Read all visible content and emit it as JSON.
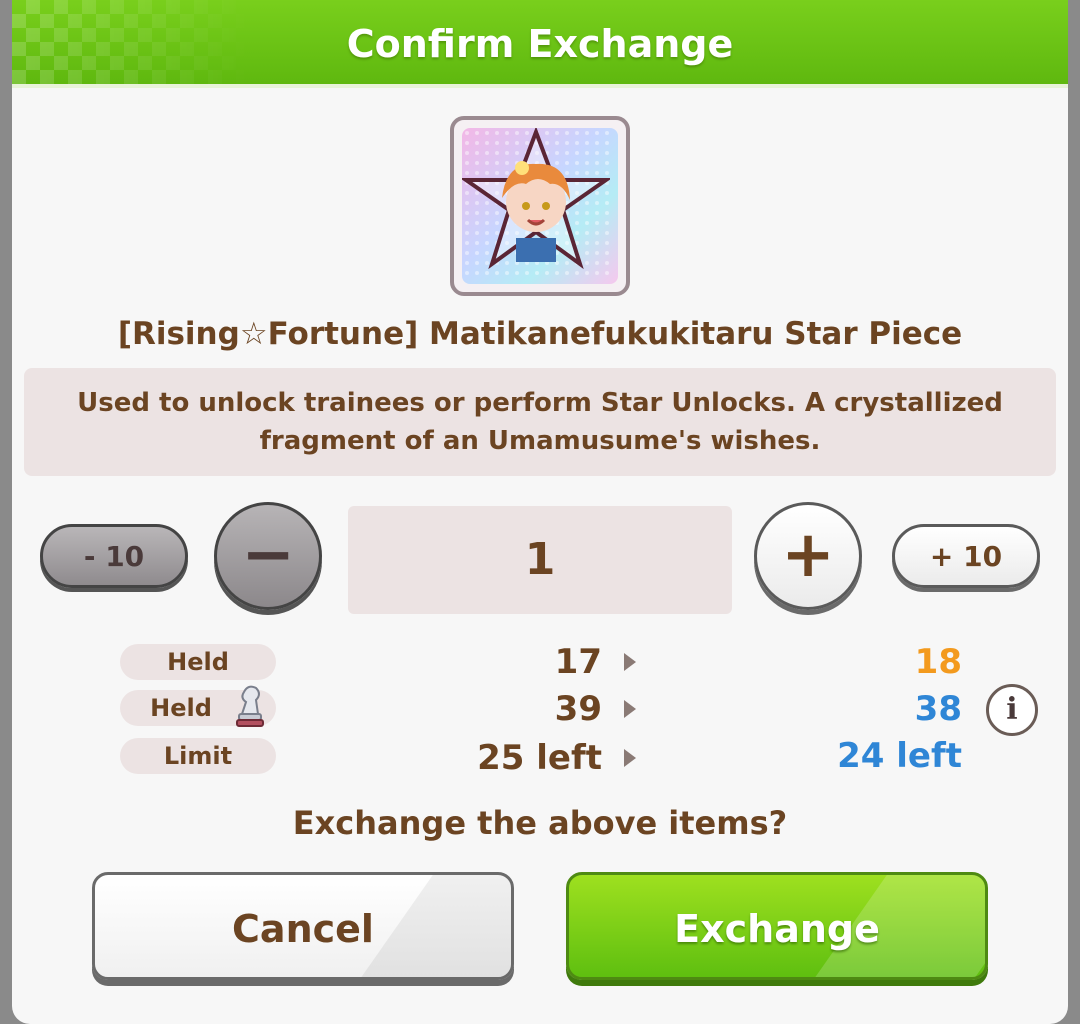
{
  "dialog": {
    "title": "Confirm Exchange",
    "item_name": "[Rising☆Fortune] Matikanefukukitaru Star Piece",
    "description_line1": "Used to unlock trainees or perform Star Unlocks. A crystallized",
    "description_line2": "fragment of an Umamusume's wishes."
  },
  "quantity": {
    "minus10_label": "- 10",
    "minus_label": "−",
    "value": "1",
    "plus_label": "+",
    "plus10_label": "+ 10"
  },
  "stats": [
    {
      "label": "Held",
      "icon": "",
      "old": "17",
      "new": "18",
      "new_color": "#f39a1e"
    },
    {
      "label": "Held",
      "icon": "chess-piece-icon",
      "old": "39",
      "new": "38",
      "new_color": "#2f86d6"
    },
    {
      "label": "Limit",
      "icon": "",
      "old": "25 left",
      "new": "24 left",
      "new_color": "#2f86d6"
    }
  ],
  "info_label": "i",
  "question": "Exchange the above items?",
  "buttons": {
    "cancel": "Cancel",
    "exchange": "Exchange"
  },
  "colors": {
    "title_green": "#6cc417",
    "text_brown": "#6b4422",
    "orange": "#f39a1e",
    "blue": "#2f86d6"
  }
}
